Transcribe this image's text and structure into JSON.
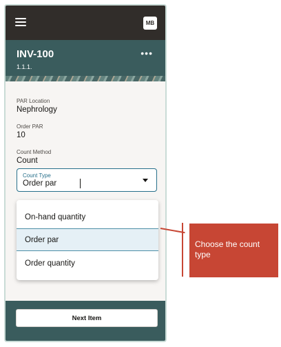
{
  "appbar": {
    "avatar_initials": "MB",
    "menu_icon": "hamburger-icon"
  },
  "banner": {
    "title": "INV-100",
    "subtitle": "1.1.1.",
    "more_icon": "more-icon",
    "more_glyph": "•••"
  },
  "fields": {
    "par_location": {
      "label": "PAR Location",
      "value": "Nephrology"
    },
    "order_par": {
      "label": "Order PAR",
      "value": "10"
    },
    "count_method": {
      "label": "Count Method",
      "value": "Count"
    }
  },
  "count_type": {
    "label": "Count Type",
    "value": "Order par",
    "options": [
      "On-hand quantity",
      "Order par",
      "Order quantity"
    ],
    "selected_index": 1
  },
  "footer": {
    "next_label": "Next Item"
  },
  "callout": {
    "text": "Choose the count type"
  },
  "colors": {
    "accent": "#266f8a",
    "banner": "#3a5c5d",
    "appbar": "#312d2a",
    "callout": "#c74634"
  }
}
